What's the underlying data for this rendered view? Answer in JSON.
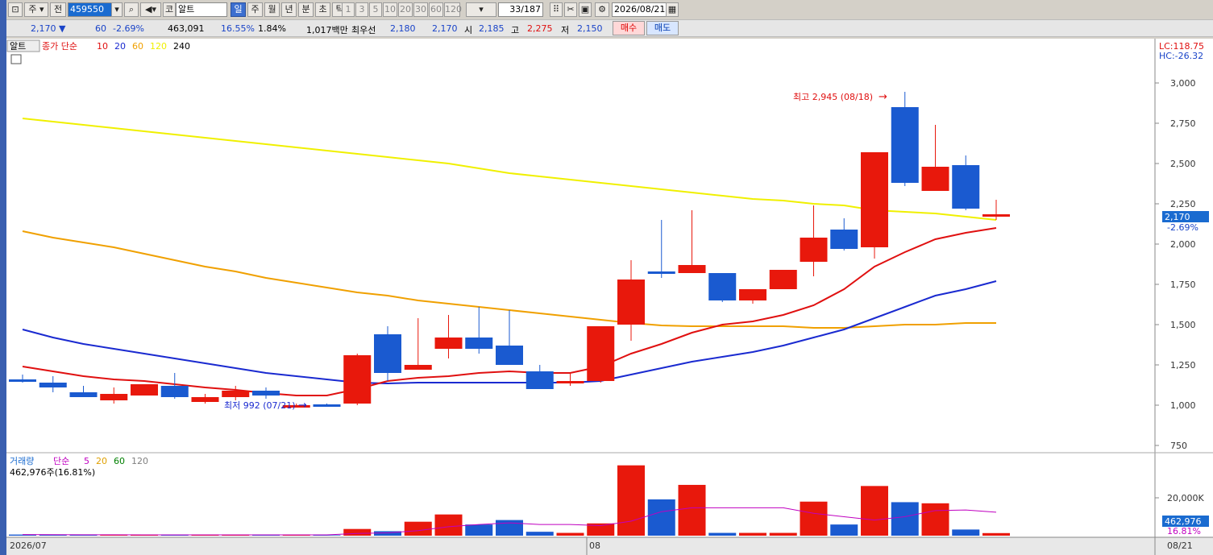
{
  "toolbar": {
    "kind_label": "주",
    "prev_label": "전",
    "stock_code": "459550",
    "market_label": "코",
    "stock_name": "알트",
    "periods": [
      "일",
      "주",
      "월",
      "년",
      "분",
      "초",
      "틱"
    ],
    "active_period": "일",
    "intervals": [
      "1",
      "3",
      "5",
      "10",
      "20",
      "30",
      "60",
      "120"
    ],
    "count_value": "33",
    "count_total": "/187",
    "date": "2026/08/21"
  },
  "info": {
    "price": "2,170 ▼",
    "change": "60",
    "change_pct": "-2.69%",
    "volume": "463,091",
    "turnover_pct": "16.55%",
    "ratio": "1.84%",
    "amount": "1,017백만",
    "best_ask_label": "최우선",
    "best_ask": "2,180",
    "best_bid": "2,170",
    "open_label": "시",
    "open": "2,185",
    "high_label": "고",
    "high": "2,275",
    "low_label": "저",
    "low": "2,150",
    "buy_label": "매수",
    "sell_label": "매도"
  },
  "price_panel": {
    "tab_label": "알트",
    "legend_title": "종가 단순",
    "ma_labels": [
      {
        "label": "10",
        "color": "#e01010"
      },
      {
        "label": "20",
        "color": "#1a2ad0"
      },
      {
        "label": "60",
        "color": "#f0a000"
      },
      {
        "label": "120",
        "color": "#f0f000"
      },
      {
        "label": "240",
        "color": "#000000"
      }
    ],
    "lc_label": "LC:118.75",
    "hc_label": "HC:-26.32",
    "high_annotation": "최고 2,945 (08/18)",
    "low_annotation": "최저 992 (07/21)",
    "current_price_tag": "2,170",
    "current_pct_tag": "-2.69%"
  },
  "volume_panel": {
    "title": "거래량",
    "legend_title": "단순",
    "ma_labels": [
      {
        "label": "5",
        "color": "#c000c0"
      },
      {
        "label": "20",
        "color": "#e0a000"
      },
      {
        "label": "60",
        "color": "#008000"
      },
      {
        "label": "120",
        "color": "#808080"
      }
    ],
    "current_label": "462,976주(16.81%)",
    "axis_label": "20,000K",
    "current_tag": "462,976",
    "pct_tag": "16.81%"
  },
  "xaxis": {
    "labels": [
      "2026/07",
      "08",
      "08/21"
    ]
  },
  "chart_data": {
    "type": "candlestick",
    "yaxis": {
      "ticks": [
        3000,
        2750,
        2500,
        2250,
        2000,
        1750,
        1500,
        1250,
        1000,
        750
      ]
    },
    "candles": [
      {
        "o": 1160,
        "h": 1190,
        "l": 1140,
        "c": 1150
      },
      {
        "o": 1140,
        "h": 1180,
        "l": 1080,
        "c": 1110
      },
      {
        "o": 1080,
        "h": 1120,
        "l": 1050,
        "c": 1050
      },
      {
        "o": 1030,
        "h": 1110,
        "l": 1010,
        "c": 1070
      },
      {
        "o": 1060,
        "h": 1130,
        "l": 1060,
        "c": 1130
      },
      {
        "o": 1120,
        "h": 1200,
        "l": 1040,
        "c": 1050
      },
      {
        "o": 1020,
        "h": 1070,
        "l": 1010,
        "c": 1050
      },
      {
        "o": 1050,
        "h": 1120,
        "l": 1030,
        "c": 1090
      },
      {
        "o": 1090,
        "h": 1110,
        "l": 1040,
        "c": 1060
      },
      {
        "o": 1000,
        "h": 1010,
        "l": 992,
        "c": 1000
      },
      {
        "o": 1005,
        "h": 1010,
        "l": 995,
        "c": 1000
      },
      {
        "o": 1010,
        "h": 1320,
        "l": 1000,
        "c": 1310
      },
      {
        "o": 1440,
        "h": 1490,
        "l": 1150,
        "c": 1200
      },
      {
        "o": 1220,
        "h": 1540,
        "l": 1220,
        "c": 1250
      },
      {
        "o": 1350,
        "h": 1560,
        "l": 1290,
        "c": 1420
      },
      {
        "o": 1420,
        "h": 1610,
        "l": 1320,
        "c": 1350
      },
      {
        "o": 1370,
        "h": 1590,
        "l": 1250,
        "c": 1250
      },
      {
        "o": 1210,
        "h": 1250,
        "l": 1100,
        "c": 1100
      },
      {
        "o": 1140,
        "h": 1200,
        "l": 1120,
        "c": 1150
      },
      {
        "o": 1150,
        "h": 1490,
        "l": 1140,
        "c": 1490
      },
      {
        "o": 1500,
        "h": 1900,
        "l": 1400,
        "c": 1780
      },
      {
        "o": 1830,
        "h": 2150,
        "l": 1790,
        "c": 1820
      },
      {
        "o": 1820,
        "h": 2210,
        "l": 1820,
        "c": 1870
      },
      {
        "o": 1820,
        "h": 1820,
        "l": 1640,
        "c": 1650
      },
      {
        "o": 1650,
        "h": 1720,
        "l": 1630,
        "c": 1720
      },
      {
        "o": 1720,
        "h": 1840,
        "l": 1720,
        "c": 1840
      },
      {
        "o": 1890,
        "h": 2240,
        "l": 1800,
        "c": 2040
      },
      {
        "o": 2090,
        "h": 2160,
        "l": 1960,
        "c": 1970
      },
      {
        "o": 1980,
        "h": 2570,
        "l": 1910,
        "c": 2570
      },
      {
        "o": 2850,
        "h": 2945,
        "l": 2360,
        "c": 2380
      },
      {
        "o": 2330,
        "h": 2740,
        "l": 2330,
        "c": 2480
      },
      {
        "o": 2490,
        "h": 2550,
        "l": 2210,
        "c": 2220
      },
      {
        "o": 2170,
        "h": 2275,
        "l": 2150,
        "c": 2185
      }
    ],
    "ma10": [
      1240,
      1210,
      1180,
      1160,
      1150,
      1130,
      1110,
      1095,
      1075,
      1060,
      1060,
      1100,
      1150,
      1170,
      1180,
      1200,
      1210,
      1200,
      1200,
      1240,
      1320,
      1380,
      1450,
      1500,
      1520,
      1560,
      1620,
      1720,
      1860,
      1950,
      2030,
      2070,
      2100
    ],
    "ma20": [
      1470,
      1420,
      1380,
      1350,
      1320,
      1290,
      1260,
      1230,
      1200,
      1180,
      1160,
      1140,
      1135,
      1140,
      1140,
      1140,
      1140,
      1140,
      1140,
      1150,
      1190,
      1230,
      1270,
      1300,
      1330,
      1370,
      1420,
      1470,
      1540,
      1610,
      1680,
      1720,
      1770
    ],
    "ma60": [
      2080,
      2040,
      2010,
      1980,
      1940,
      1900,
      1860,
      1830,
      1790,
      1760,
      1730,
      1700,
      1680,
      1650,
      1630,
      1610,
      1590,
      1570,
      1550,
      1530,
      1510,
      1495,
      1490,
      1490,
      1490,
      1490,
      1480,
      1480,
      1490,
      1500,
      1500,
      1510,
      1510
    ],
    "ma120": [
      2780,
      2760,
      2740,
      2720,
      2700,
      2680,
      2660,
      2640,
      2620,
      2600,
      2580,
      2560,
      2540,
      2520,
      2500,
      2470,
      2440,
      2420,
      2400,
      2380,
      2360,
      2340,
      2320,
      2300,
      2280,
      2270,
      2250,
      2240,
      2210,
      2200,
      2190,
      2170,
      2150
    ],
    "volume_ticks": [
      20000
    ],
    "volumes": [
      200,
      150,
      150,
      120,
      150,
      150,
      150,
      200,
      150,
      100,
      100,
      1200,
      800,
      2500,
      3800,
      2000,
      2800,
      700,
      500,
      2200,
      12600,
      6500,
      9100,
      500,
      500,
      500,
      6100,
      2000,
      8900,
      6000,
      5800,
      1100,
      463
    ],
    "vol_ma5": [
      200,
      180,
      170,
      160,
      150,
      150,
      150,
      150,
      150,
      150,
      150,
      400,
      500,
      900,
      1600,
      2000,
      2300,
      2000,
      2000,
      1800,
      2600,
      4300,
      5000,
      5000,
      5000,
      5000,
      4000,
      3400,
      2800,
      3400,
      4500,
      4600,
      4200
    ]
  }
}
